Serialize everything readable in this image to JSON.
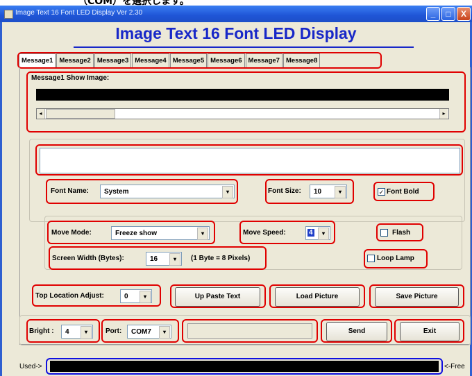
{
  "top_text": "（COM）を選択します。",
  "window": {
    "title": "Image Text 16 Font LED Display Ver 2.30",
    "minimize": "_",
    "maximize": "□",
    "close": "X"
  },
  "header": {
    "title": "Image Text 16 Font LED Display"
  },
  "tabs": [
    "Message1",
    "Message2",
    "Message3",
    "Message4",
    "Message5",
    "Message6",
    "Message7",
    "Message8"
  ],
  "preview": {
    "label": "Message1 Show Image:",
    "left_arrow": "◂",
    "right_arrow": "▸"
  },
  "text_input": {
    "value": ""
  },
  "font": {
    "name_label": "Font Name:",
    "name_value": "System",
    "size_label": "Font Size:",
    "size_value": "10",
    "bold_label": "Font Bold",
    "bold_checked": "✓"
  },
  "move": {
    "mode_label": "Move Mode:",
    "mode_value": "Freeze show",
    "speed_label": "Move Speed:",
    "speed_value": "4",
    "flash_label": "Flash"
  },
  "screen": {
    "width_label": "Screen Width (Bytes):",
    "width_value": "16",
    "note": "(1 Byte = 8 Pixels)",
    "loop_label": "Loop Lamp"
  },
  "actions": {
    "top_adjust_label": "Top Location Adjust:",
    "top_adjust_value": "0",
    "up_paste": "Up Paste Text",
    "load_picture": "Load Picture",
    "save_picture": "Save Picture"
  },
  "bottom": {
    "bright_label": "Bright :",
    "bright_value": "4",
    "port_label": "Port:",
    "port_value": "COM7",
    "send": "Send",
    "exit": "Exit"
  },
  "usage": {
    "used_label": "Used->",
    "free_label": "<-Free"
  },
  "dropdown_arrow": "▾",
  "colors": {
    "highlight": "#e00000",
    "accent_blue": "#1010e0",
    "title_blue": "#1828c8"
  }
}
